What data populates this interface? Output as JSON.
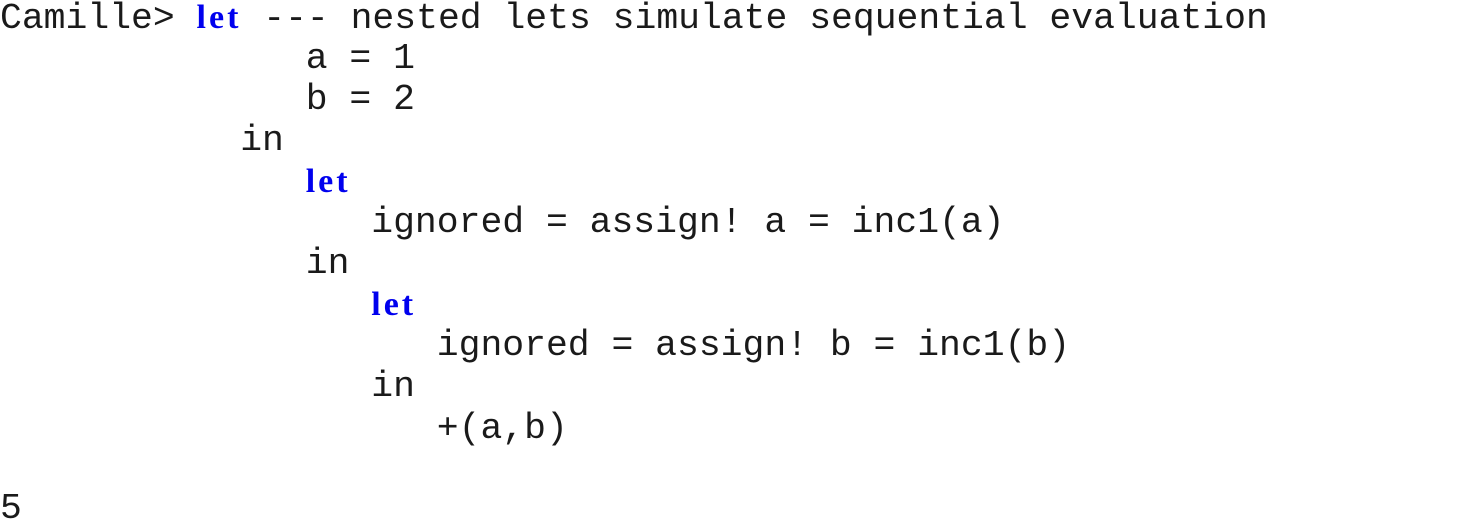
{
  "console": {
    "prompt": "Camille> ",
    "keyword_color": "#0000ee",
    "lines": [
      {
        "indent": "",
        "keyword": "let",
        "text": " --- nested lets simulate sequential evaluation"
      },
      {
        "indent": "              ",
        "keyword": "",
        "text": "a = 1"
      },
      {
        "indent": "              ",
        "keyword": "",
        "text": "b = 2"
      },
      {
        "indent": "           ",
        "keyword": "",
        "text": "in"
      },
      {
        "indent": "              ",
        "keyword": "let",
        "text": ""
      },
      {
        "indent": "                 ",
        "keyword": "",
        "text": "ignored = assign! a = inc1(a)"
      },
      {
        "indent": "              ",
        "keyword": "",
        "text": "in"
      },
      {
        "indent": "                 ",
        "keyword": "let",
        "text": ""
      },
      {
        "indent": "                    ",
        "keyword": "",
        "text": "ignored = assign! b = inc1(b)"
      },
      {
        "indent": "                 ",
        "keyword": "",
        "text": "in"
      },
      {
        "indent": "                    ",
        "keyword": "",
        "text": "+(a,b)"
      }
    ],
    "result": "5"
  }
}
